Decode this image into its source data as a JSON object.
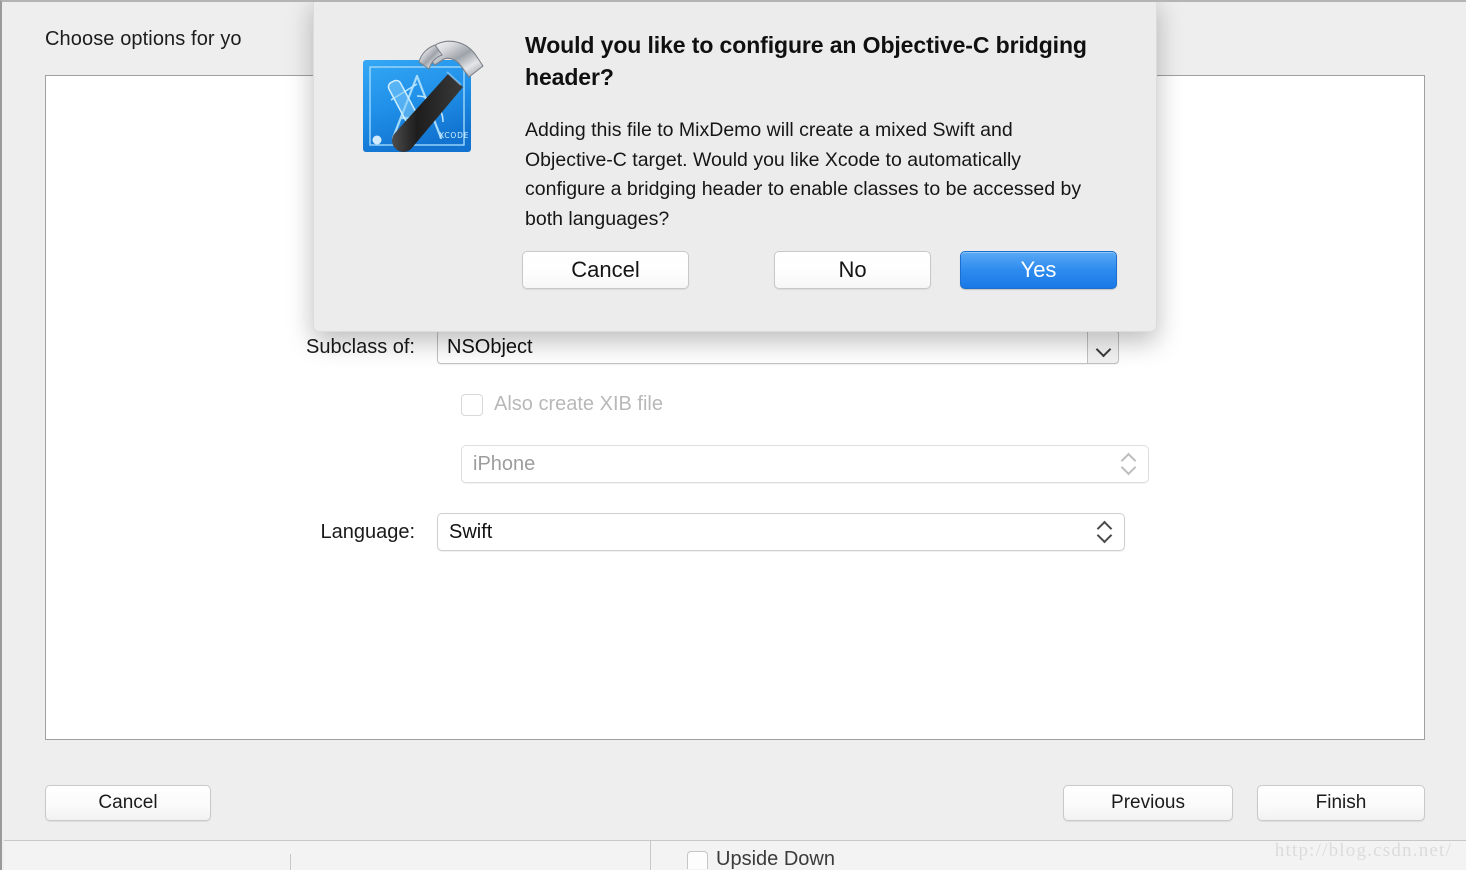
{
  "window": {
    "sheet_title": "Choose options for yo",
    "background_color": "#eeeeee"
  },
  "form": {
    "subclass": {
      "label": "Subclass of:",
      "value": "NSObject",
      "arrow_icon": "chevron-down-icon"
    },
    "xib_checkbox": {
      "label": "Also create XIB file",
      "checked": false,
      "enabled": false
    },
    "device": {
      "value": "iPhone",
      "enabled": false,
      "stepper_icon": "chevron-up-down-icon"
    },
    "language": {
      "label": "Language:",
      "value": "Swift",
      "enabled": true,
      "stepper_icon": "chevron-up-down-icon"
    }
  },
  "footer": {
    "cancel_label": "Cancel",
    "previous_label": "Previous",
    "finish_label": "Finish"
  },
  "alert": {
    "icon_name": "xcode-app-icon",
    "title": "Would you like to configure an Objective-C bridging header?",
    "message": "Adding this file to MixDemo will create a mixed Swift and Objective-C target. Would you like Xcode to automatically configure a bridging header to enable classes to be accessed by both languages?",
    "buttons": {
      "cancel_label": "Cancel",
      "no_label": "No",
      "yes_label": "Yes"
    },
    "accent_color": "#2f8cef"
  },
  "background_bottom": {
    "checkbox_label": "Upside Down"
  },
  "watermark": {
    "text": "http://blog.csdn.net/"
  }
}
